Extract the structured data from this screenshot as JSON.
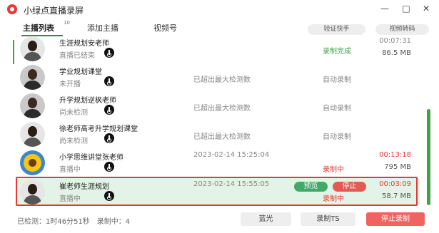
{
  "app": {
    "title": "小绿点直播录屏"
  },
  "window": {
    "minimize": "—",
    "maximize": "□",
    "close": "✕"
  },
  "tabs": [
    {
      "label": "主播列表",
      "badge": "10"
    },
    {
      "label": "添加主播"
    },
    {
      "label": "视频号"
    }
  ],
  "top_buttons": {
    "verify": "验证快手",
    "convert": "视频转码"
  },
  "rows": [
    {
      "name": "生涯规划安老师",
      "status": "直播已结束",
      "mid": "",
      "mode": "录制完成",
      "duration": "00:07:31",
      "size": "86.5 MB"
    },
    {
      "name": "学业规划课堂",
      "status": "未开播",
      "mid": "已超出最大检测数",
      "mode": "自动录制",
      "duration": "",
      "size": ""
    },
    {
      "name": "升学规划逆枫老师",
      "status": "尚未检测",
      "mid": "已超出最大检测数",
      "mode": "自动录制",
      "duration": "",
      "size": ""
    },
    {
      "name": "徐老师高考升学规划课堂",
      "status": "尚未检测",
      "mid": "已超出最大检测数",
      "mode": "自动录制",
      "duration": "",
      "size": ""
    },
    {
      "name": "小学思维讲堂张老师",
      "status": "直播中",
      "mid": "2023-02-14 15:25:04",
      "mode": "录制中",
      "duration": "00:13:18",
      "size": "795 MB"
    },
    {
      "name": "崔老师生涯规划",
      "status": "直播中",
      "mid": "2023-02-14 15:55:05",
      "mode": "录制中",
      "duration": "00:03:09",
      "size": "58.7 MB",
      "preview": "预览",
      "stop": "停止"
    }
  ],
  "footer": {
    "summary": "已检测：1时46分51秒　录制中：4",
    "bluray": "蓝光",
    "record_ts": "录制TS",
    "stop_recording": "停止录制"
  },
  "colors": {
    "accent": "#43a047",
    "danger": "#e53935",
    "selected_row": "#e4f3e8"
  },
  "icons": [
    "app-logo-icon",
    "douyin-icon"
  ]
}
